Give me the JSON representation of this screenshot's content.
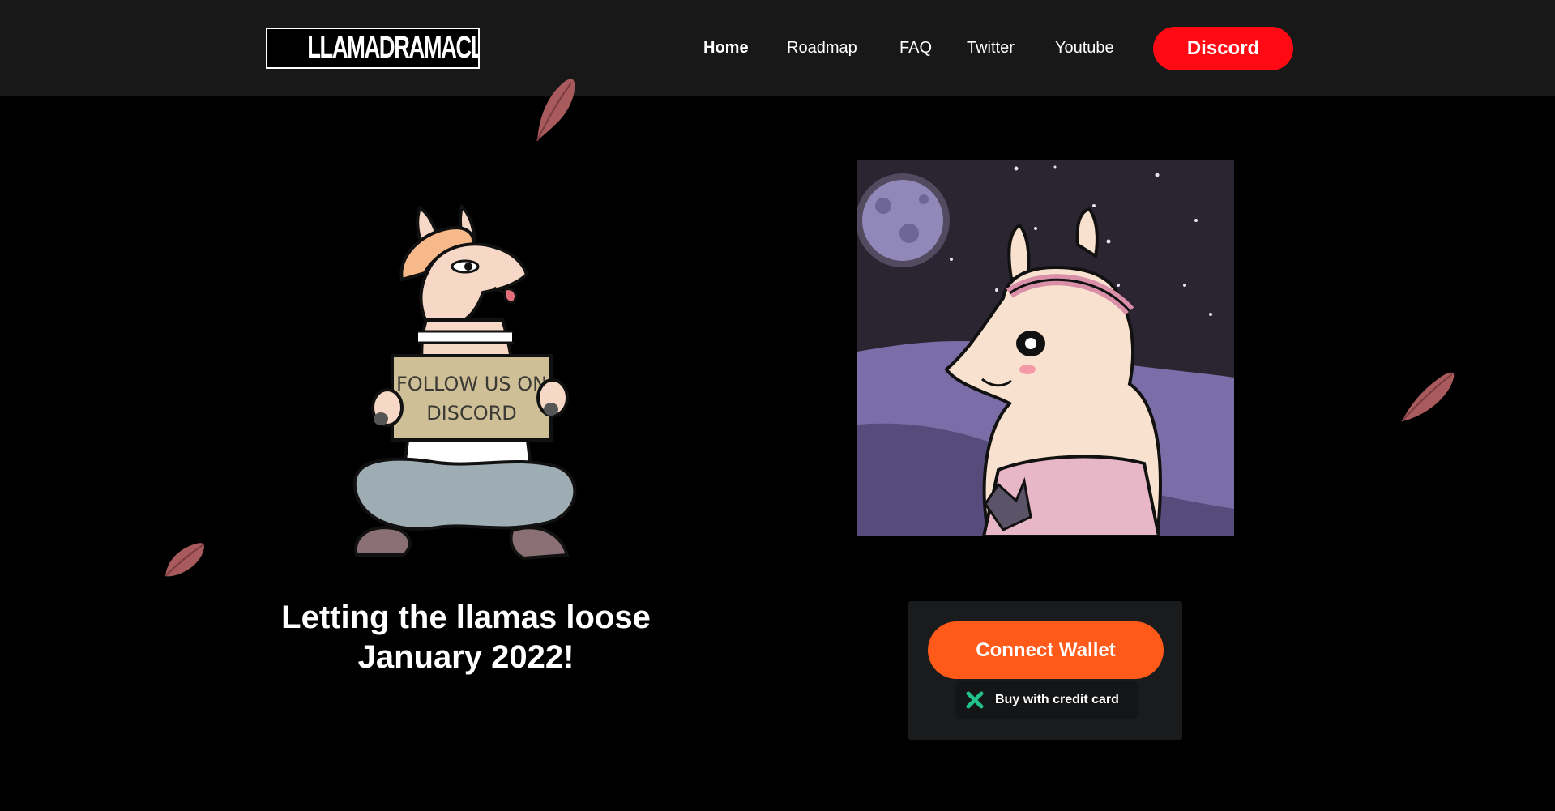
{
  "header": {
    "logo_text": "LLAMADRAMACLUB",
    "nav": [
      {
        "label": "Home",
        "active": true
      },
      {
        "label": "Roadmap"
      },
      {
        "label": "FAQ"
      },
      {
        "label": "Twitter"
      },
      {
        "label": "Youtube"
      }
    ],
    "discord_label": "Discord"
  },
  "hero": {
    "sign_text_line1": "FOLLOW US ON",
    "sign_text_line2": "DISCORD",
    "headline": "Letting the llamas loose January 2022!"
  },
  "mint": {
    "connect_label": "Connect Wallet",
    "credit_label": "Buy with credit card"
  },
  "colors": {
    "discord_red": "#ff0a14",
    "connect_orange": "#ff5a1a",
    "leaf": "#a85a5c",
    "credit_icon": "#22c08a"
  }
}
